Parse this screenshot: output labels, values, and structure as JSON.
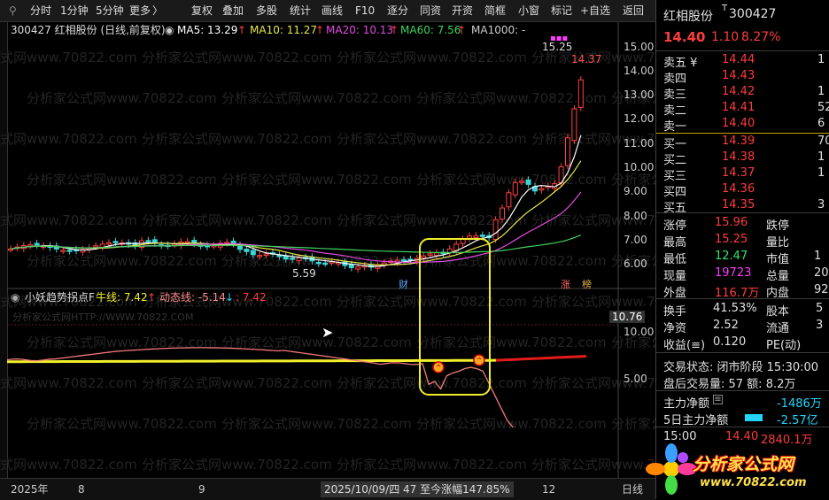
{
  "toolbar": {
    "items": [
      "分时",
      "1分钟",
      "5分钟",
      "更多",
      "复权",
      "叠加",
      "多股",
      "统计",
      "画线",
      "F10",
      "逐分",
      "同资",
      "开资",
      "简框",
      "小窗",
      "标记",
      "+自选",
      "返回"
    ],
    "more_arrow": "〉"
  },
  "main_legend": {
    "code_name": "300427 红相股份 (日线,前复权)",
    "ma5": "MA5: 13.29",
    "ma10": "MA10: 11.27",
    "ma20": "MA20: 10.13",
    "ma60": "MA60: 7.56",
    "ma1000": "MA1000: -",
    "arrow": "↑"
  },
  "price_axis": [
    "15.00",
    "14.00",
    "13.00",
    "12.00",
    "11.00",
    "10.00",
    "9.00",
    "8.00",
    "7.00",
    "6.00"
  ],
  "annotations": {
    "high_label": "15.25",
    "last_high": "14.37",
    "low_label": "5.59",
    "cai": "财",
    "zhang": "涨",
    "bang": "榜"
  },
  "indicator": {
    "name": "小妖趋势拐点F",
    "niu_label": "牛线: 7.42",
    "dong_label": "动态线: -5.14",
    "val3": ": 7.42",
    "up": "↑",
    "down": "↓",
    "axis_top": "10.76",
    "axis_10": "10.00",
    "axis_5": "5.00",
    "watermark_url": "分析家公式网HTTP://WWW.70822.COM"
  },
  "bottom": {
    "year": "2025年",
    "m8": "8",
    "m9": "9",
    "date_info": "2025/10/09/四  47  至今涨幅147.85%",
    "m12": "12",
    "period": "日线"
  },
  "quote": {
    "name": "红相股份",
    "code": "300427",
    "price": "14.40",
    "change": "1.10",
    "pct": "8.27%",
    "asks": [
      {
        "label": "卖五 ¥",
        "price": "14.44",
        "vol": "1"
      },
      {
        "label": "卖四",
        "price": "14.43",
        "vol": ""
      },
      {
        "label": "卖三",
        "price": "14.42",
        "vol": "1"
      },
      {
        "label": "卖二",
        "price": "14.41",
        "vol": "52"
      },
      {
        "label": "卖一",
        "price": "14.40",
        "vol": "6"
      }
    ],
    "bids": [
      {
        "label": "买一",
        "price": "14.39",
        "vol": "70"
      },
      {
        "label": "买二",
        "price": "14.38",
        "vol": "1"
      },
      {
        "label": "买三",
        "price": "14.37",
        "vol": "1"
      },
      {
        "label": "买四",
        "price": "14.36",
        "vol": ""
      },
      {
        "label": "买五",
        "price": "14.35",
        "vol": "3"
      }
    ],
    "stats": [
      {
        "l1": "涨停",
        "v1": "15.96",
        "l2": "跌停",
        "v2": ""
      },
      {
        "l1": "最高",
        "v1": "15.25",
        "l2": "量比",
        "v2": ""
      },
      {
        "l1": "最低",
        "v1": "12.47",
        "l2": "市值",
        "v2": "1"
      },
      {
        "l1": "现量",
        "v1": "19723",
        "l2": "总量",
        "v2": "20"
      },
      {
        "l1": "外盘",
        "v1": "116.7万",
        "l2": "内盘",
        "v2": "92"
      }
    ],
    "fund": [
      {
        "l1": "换手",
        "v1": "41.53%",
        "l2": "股本",
        "v2": "5"
      },
      {
        "l1": "净资",
        "v1": "2.52",
        "l2": "流通",
        "v2": "3"
      },
      {
        "l1": "收益(≡)",
        "v1": "0.120",
        "l2": "PE(动)",
        "v2": ""
      }
    ],
    "trade_state": "交易状态: 闭市阶段 15:30:00",
    "after_hours": "盘后交易量: 57  额: 8.2万",
    "main_net_label": "主力净额",
    "main_net_val": "-1486万",
    "five_day_label": "5日主力净额",
    "five_day_val": "-2.57亿",
    "tick_time": "15:00",
    "tick_price": "14.40",
    "tick_vol": "2840.1万"
  },
  "logo": {
    "title": "分析家公式网",
    "url": "www.70822.com"
  },
  "watermark": "分析家公式网www.70822.com"
}
